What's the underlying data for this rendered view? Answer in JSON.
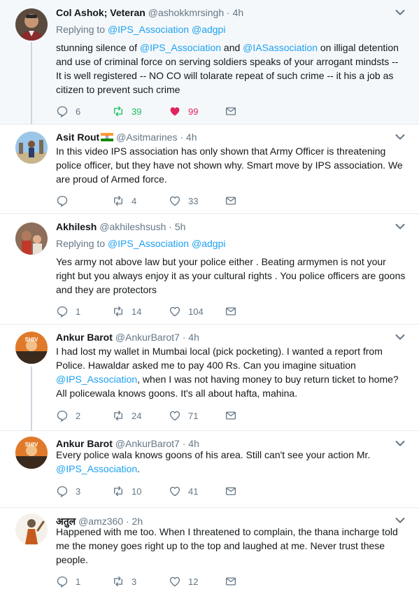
{
  "tweets": [
    {
      "name": "Col Ashok; Veteran",
      "handle": "@ashokkmrsingh",
      "dot": "·",
      "time": "4h",
      "replying_label": "Replying to",
      "replying_to": [
        "@IPS_Association",
        "@adgpi"
      ],
      "text_parts": [
        "stunning silence of ",
        "@IPS_Association",
        " and ",
        "@IASassociation",
        " on illigal detention and use of criminal force on serving soldiers speaks of your arrogant mindsts -- It is well registered -- NO CO will tolarate repeat of such crime -- it his a job as citizen to prevent such crime"
      ],
      "replies": "6",
      "retweets": "39",
      "likes": "99",
      "retweeted": true,
      "liked": true
    },
    {
      "name": "Asit Rout",
      "handle": "@Asitmarines",
      "dot": "·",
      "time": "4h",
      "flag_icon": "india-flag-icon",
      "text": "In this video IPS association has only shown that Army Officer is threatening police officer, but they have not shown why. Smart move by IPS association. We are proud of Armed force.",
      "replies": "",
      "retweets": "4",
      "likes": "33"
    },
    {
      "name": "Akhilesh",
      "handle": "@akhileshsush",
      "dot": "·",
      "time": "5h",
      "replying_label": "Replying to",
      "replying_to": [
        "@IPS_Association",
        "@adgpi"
      ],
      "text": "Yes army not above law but your police either . Beating armymen is not your right but you always enjoy it as your cultural rights . You police officers are goons and they are protectors",
      "replies": "1",
      "retweets": "14",
      "likes": "104"
    },
    {
      "name": "Ankur Barot",
      "handle": "@AnkurBarot7",
      "dot": "·",
      "time": "4h",
      "text_parts": [
        "I had lost my wallet in Mumbai local (pick pocketing). I wanted a report from Police. Hawaldar asked me to pay 400 Rs. Can you imagine situation ",
        "@IPS_Association",
        ", when I was not having money to buy return ticket to home? All policewala knows goons. It's all about hafta, mahina."
      ],
      "replies": "2",
      "retweets": "24",
      "likes": "71"
    },
    {
      "name": "Ankur Barot",
      "handle": "@AnkurBarot7",
      "dot": "·",
      "time": "4h",
      "text_parts": [
        "Every police wala knows goons of his area. Still can't see your action Mr. ",
        "@IPS_Association",
        "."
      ],
      "replies": "3",
      "retweets": "10",
      "likes": "41"
    },
    {
      "name": "अतुल",
      "handle": "@amz360",
      "dot": "·",
      "time": "2h",
      "text": "Happened with me too. When I threatened to complain, the thana incharge told me the money goes right up to the top and laughed at me. Never trust these people.",
      "replies": "1",
      "retweets": "3",
      "likes": "12"
    }
  ],
  "colors": {
    "link": "#1da1f2",
    "secondary": "#657786",
    "retweet_active": "#17bf63",
    "like_active": "#e0245e",
    "highlight_bg": "#f5f8fa",
    "divider": "#e6ecf0"
  },
  "icons": {
    "reply": "reply-icon",
    "retweet": "retweet-icon",
    "like": "heart-icon",
    "dm": "envelope-icon",
    "menu": "chevron-down-icon"
  }
}
